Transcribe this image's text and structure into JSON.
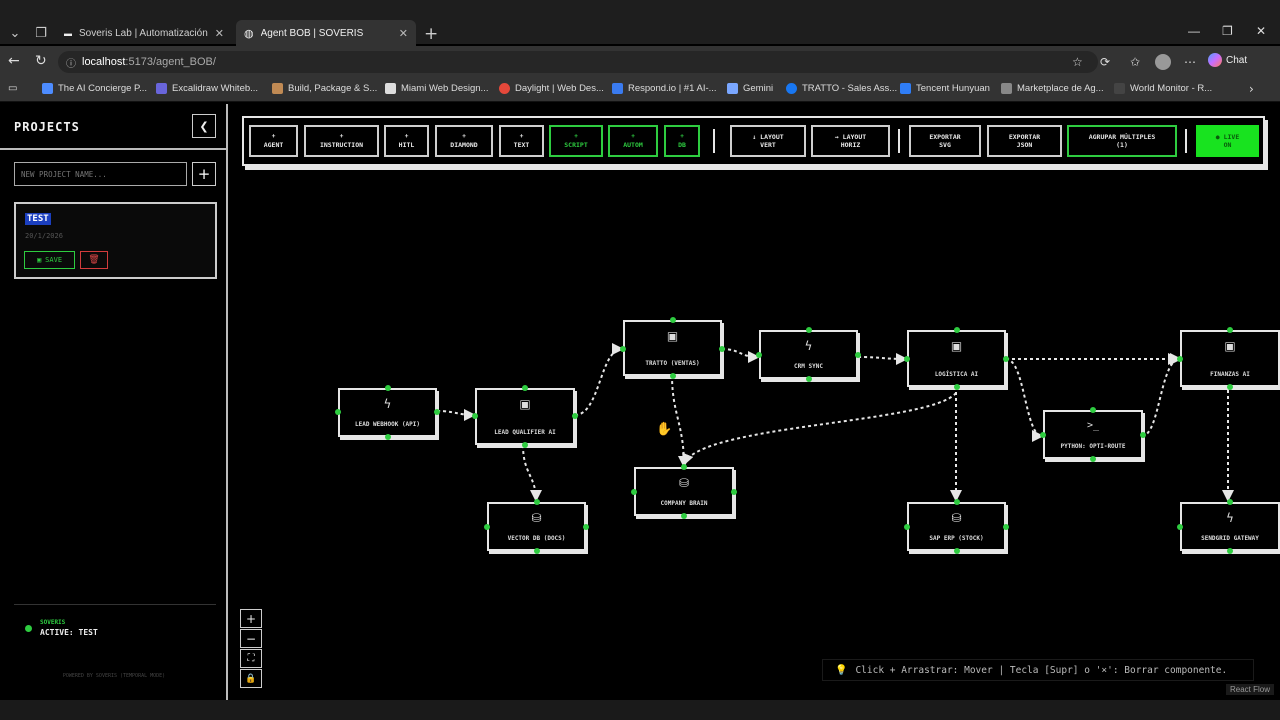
{
  "browser": {
    "tabs": [
      {
        "title": "Soveris Lab | Automatización e IA",
        "active": false
      },
      {
        "title": "Agent BOB | SOVERIS",
        "active": true
      }
    ],
    "url_host": "localhost",
    "url_path": ":5173/agent_BOB/",
    "chat_label": "Chat",
    "bookmarks": [
      "The AI Concierge P...",
      "Excalidraw Whiteb...",
      "Build, Package & S...",
      "Miami Web Design...",
      "Daylight | Web Des...",
      "Respond.io | #1 AI-...",
      "Gemini",
      "TRATTO - Sales Ass...",
      "Tencent Hunyuan",
      "Marketplace de Ag...",
      "World Monitor - R..."
    ]
  },
  "sidebar": {
    "title": "PROJECTS",
    "new_project_placeholder": "NEW PROJECT NAME...",
    "project": {
      "name": "TEST",
      "date": "20/1/2026",
      "save_label": "SAVE"
    },
    "status_brand": "SOVERIS",
    "status_text": "ACTIVE: TEST",
    "powered": "POWERED BY SOVERIS (TEMPORAL MODE)"
  },
  "toolbar": {
    "buttons": [
      {
        "icon": "+",
        "label": "AGENT"
      },
      {
        "icon": "+",
        "label": "INSTRUCTION"
      },
      {
        "icon": "+",
        "label": "HITL"
      },
      {
        "icon": "+",
        "label": "DIAMOND"
      },
      {
        "icon": "+",
        "label": "TEXT"
      },
      {
        "icon": "+",
        "label": "SCRIPT"
      },
      {
        "icon": "+",
        "label": "AUTOM"
      },
      {
        "icon": "+",
        "label": "DB"
      },
      {
        "icon": "↓ LAYOUT",
        "label": "VERT"
      },
      {
        "icon": "→ LAYOUT",
        "label": "HORIZ"
      },
      {
        "icon": "EXPORTAR",
        "label": "SVG"
      },
      {
        "icon": "EXPORTAR",
        "label": "JSON"
      },
      {
        "icon": "AGRUPAR MÚLTIPLES",
        "label": "(1)"
      },
      {
        "icon": "● LIVE",
        "label": "ON"
      }
    ]
  },
  "nodes": [
    {
      "icon": "bolt-icon",
      "label": "LEAD WEBHOOK (API)"
    },
    {
      "icon": "agent-icon",
      "label": "LEAD QUALIFIER AI"
    },
    {
      "icon": "db-icon",
      "label": "VECTOR DB (DOCS)"
    },
    {
      "icon": "agent-icon",
      "label": "TRATTO (VENTAS)"
    },
    {
      "icon": "db-icon",
      "label": "COMPANY BRAIN"
    },
    {
      "icon": "bolt-icon",
      "label": "CRM SYNC"
    },
    {
      "icon": "agent-icon",
      "label": "LOGÍSTICA AI"
    },
    {
      "icon": "db-icon",
      "label": "SAP ERP (STOCK)"
    },
    {
      "icon": "terminal-icon",
      "label": "PYTHON: OPTI-ROUTE"
    },
    {
      "icon": "agent-icon",
      "label": "FINANZAS AI"
    },
    {
      "icon": "bolt-icon",
      "label": "SENDGRID GATEWAY"
    }
  ],
  "hint": "Click + Arrastrar: Mover | Tecla [Supr] o '×': Borrar componente.",
  "attribution": "React Flow",
  "colors": {
    "accent": "#2ecc40",
    "live": "#18e31f",
    "danger": "#d23c3c",
    "border": "#e6e6e6"
  }
}
